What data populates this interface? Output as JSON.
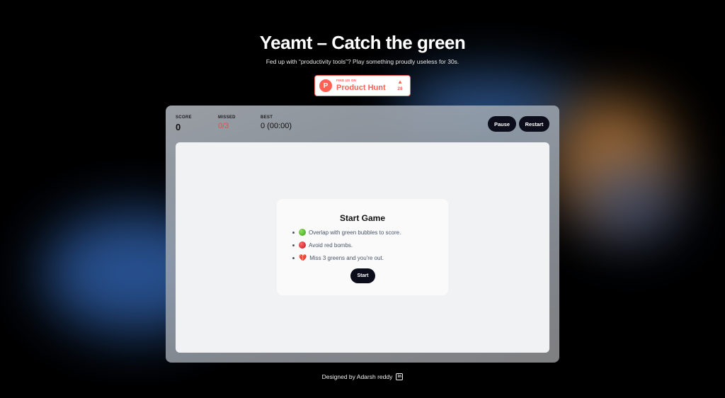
{
  "header": {
    "title": "Yeamt – Catch the green",
    "subtitle": "Fed up with “productivity tools”? Play something proudly useless for 30s."
  },
  "product_hunt": {
    "small_label": "FIND US ON",
    "name": "Product Hunt",
    "logo_letter": "P",
    "vote_count": "28",
    "accent": "#ff6154"
  },
  "stats": {
    "score_label": "SCORE",
    "score_value": "0",
    "missed_label": "MISSED",
    "missed_value": "0/3",
    "best_label": "BEST",
    "best_value": "0 (00:00)"
  },
  "controls": {
    "pause_label": "Pause",
    "restart_label": "Restart"
  },
  "start_dialog": {
    "title": "Start Game",
    "rules": [
      {
        "icon": "green-circle-icon",
        "text": "Overlap with green bubbles to score."
      },
      {
        "icon": "red-circle-icon",
        "text": "Avoid red bombs."
      },
      {
        "icon": "broken-heart-icon",
        "text": "Miss 3 greens and you're out."
      }
    ],
    "start_label": "Start"
  },
  "footer": {
    "text": "Designed by Adarsh reddy",
    "icon": "linkedin-icon",
    "icon_glyph": "in"
  },
  "colors": {
    "background": "#000000",
    "button": "#0b0d1a",
    "missed": "#d9534f"
  }
}
